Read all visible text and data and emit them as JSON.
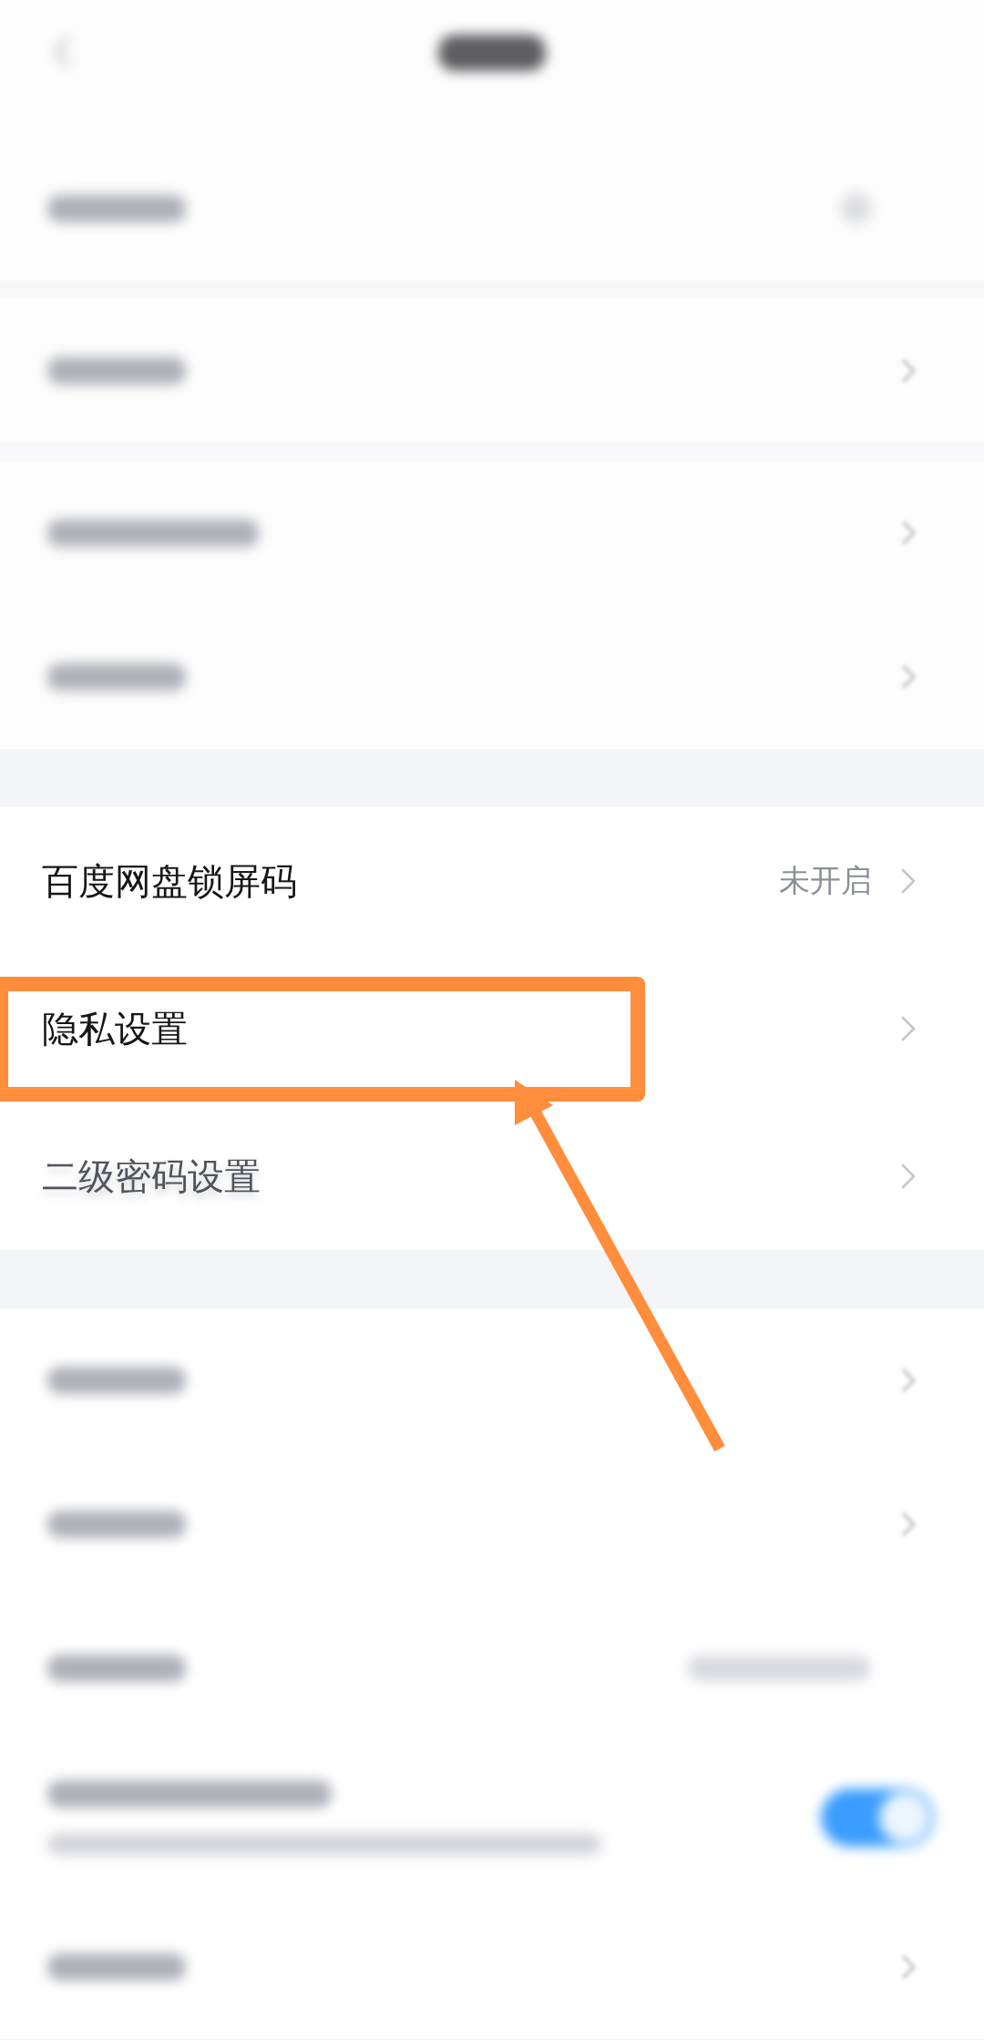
{
  "header": {
    "kind": "blurred"
  },
  "sections": [
    {
      "rows": [
        {
          "kind": "blurred",
          "chevron": false,
          "icon": true
        }
      ]
    },
    {
      "rows": [
        {
          "kind": "blurred",
          "chevron": true,
          "icon": false
        }
      ]
    },
    {
      "rows": [
        {
          "kind": "blurred_long",
          "chevron": true,
          "icon": false
        },
        {
          "kind": "blurred",
          "chevron": true,
          "icon": false
        }
      ]
    },
    {
      "rows": [
        {
          "kind": "text",
          "label": "百度网盘锁屏码",
          "value": "未开启",
          "chevron": true,
          "highlighted": false,
          "faded": false
        },
        {
          "kind": "text",
          "label": "隐私设置",
          "chevron": true,
          "highlighted": true,
          "faded": false
        },
        {
          "kind": "text",
          "label": "二级密码设置",
          "chevron": true,
          "highlighted": false,
          "faded": true
        }
      ]
    },
    {
      "rows": [
        {
          "kind": "blurred",
          "chevron": true,
          "icon": false
        },
        {
          "kind": "blurred",
          "chevron": true,
          "icon": false
        },
        {
          "kind": "blurred_with_value",
          "chevron": false,
          "icon": false
        },
        {
          "kind": "blurred_two_line",
          "chevron": false,
          "icon": false,
          "toggle": {
            "on": true
          }
        },
        {
          "kind": "blurred",
          "chevron": true,
          "icon": false
        }
      ]
    }
  ]
}
